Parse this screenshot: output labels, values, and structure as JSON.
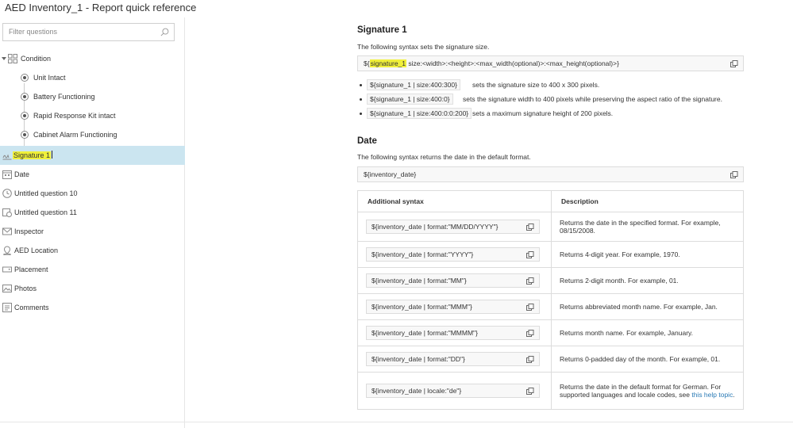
{
  "window": {
    "title": "AED Inventory_1 - Report quick reference"
  },
  "sidebar": {
    "filter_placeholder": "Filter questions",
    "items": [
      {
        "label": "Condition",
        "icon": "group-icon",
        "expanded": true
      },
      {
        "label": "Unit Intact",
        "icon": "radio-icon"
      },
      {
        "label": "Battery Functioning",
        "icon": "radio-icon"
      },
      {
        "label": "Rapid Response Kit intact",
        "icon": "radio-icon"
      },
      {
        "label": "Cabinet Alarm Functioning",
        "icon": "radio-icon"
      },
      {
        "label": "Signature 1",
        "icon": "signature-icon",
        "selected": true
      },
      {
        "label": "Date",
        "icon": "calendar-icon"
      },
      {
        "label": "Untitled question 10",
        "icon": "clock-icon"
      },
      {
        "label": "Untitled question 11",
        "icon": "calendar-clock-icon"
      },
      {
        "label": "Inspector",
        "icon": "mail-icon"
      },
      {
        "label": "AED Location",
        "icon": "location-icon"
      },
      {
        "label": "Placement",
        "icon": "dropdown-icon"
      },
      {
        "label": "Photos",
        "icon": "image-icon"
      },
      {
        "label": "Comments",
        "icon": "text-icon"
      }
    ]
  },
  "main": {
    "signature": {
      "heading": "Signature 1",
      "intro": "The following syntax sets the signature size.",
      "syntax_highlight": "signature_1",
      "syntax_rest": " size:<width>:<height>:<max_width(optional)>:<max_height(optional)>}",
      "bullets": [
        {
          "code": "${signature_1 | size:400:300}",
          "text": "sets the signature size to 400 x 300 pixels."
        },
        {
          "code": "${signature_1 | size:400:0}",
          "text": "sets the signature width to 400 pixels while preserving the aspect ratio of the signature."
        },
        {
          "code": "${signature_1 | size:400:0:0:200}",
          "text": "sets a maximum signature height of 200 pixels."
        }
      ]
    },
    "date": {
      "heading": "Date",
      "intro": "The following syntax returns the date in the default format.",
      "syntax": "${inventory_date}",
      "table": {
        "headers": [
          "Additional syntax",
          "Description"
        ],
        "rows": [
          {
            "syntax": "${inventory_date | format:\"MM/DD/YYYY\"}",
            "desc": "Returns the date in the specified format. For example, 08/15/2008."
          },
          {
            "syntax": "${inventory_date | format:\"YYYY\"}",
            "desc": "Returns 4-digit year. For example, 1970."
          },
          {
            "syntax": "${inventory_date | format:\"MM\"}",
            "desc": "Returns 2-digit month. For example, 01."
          },
          {
            "syntax": "${inventory_date | format:\"MMM\"}",
            "desc": "Returns abbreviated month name. For example, Jan."
          },
          {
            "syntax": "${inventory_date | format:\"MMMM\"}",
            "desc": "Returns month name. For example, January."
          },
          {
            "syntax": "${inventory_date | format:\"DD\"}",
            "desc": "Returns 0-padded day of the month. For example, 01."
          },
          {
            "syntax": "${inventory_date | locale:\"de\"}",
            "desc": "Returns the date in the default format for German. For supported languages and locale codes, see ",
            "link": "this help topic",
            "desc_end": "."
          }
        ]
      }
    }
  }
}
